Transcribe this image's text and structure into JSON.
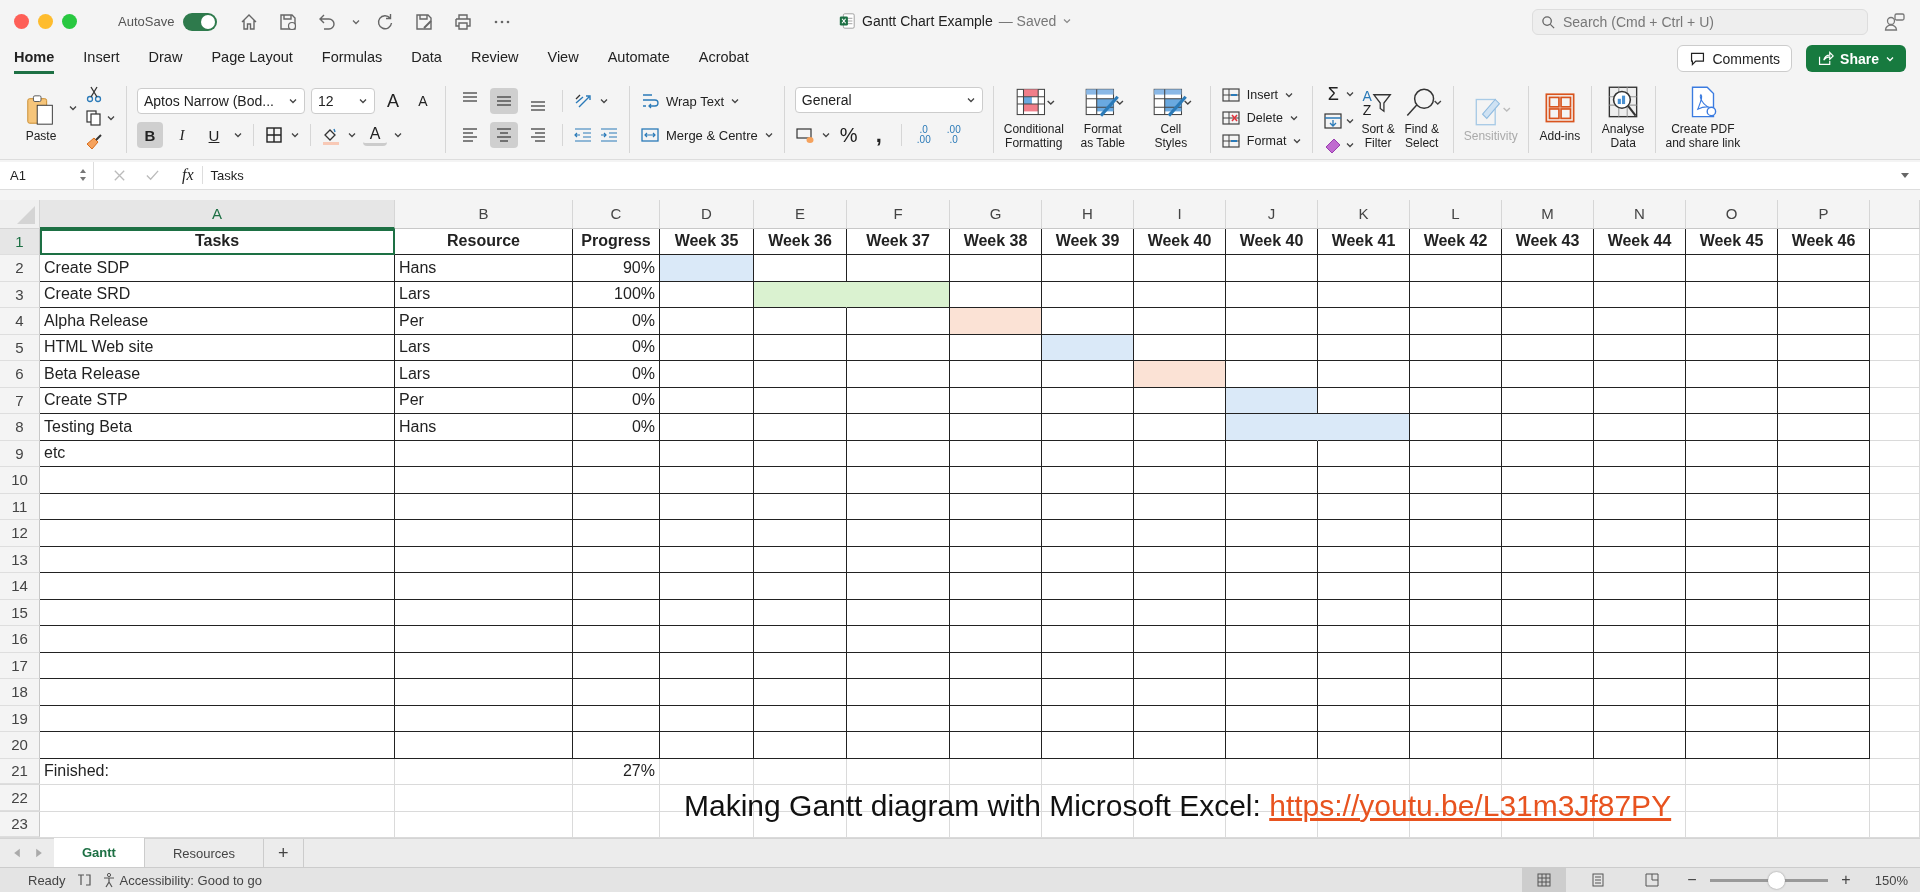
{
  "title_bar": {
    "autosave_label": "AutoSave",
    "autosave_on": true,
    "title": "Gantt Chart Example",
    "status": "— Saved",
    "search_placeholder": "Search (Cmd + Ctrl + U)"
  },
  "ribbon_tabs": [
    {
      "label": "Home",
      "selected": true
    },
    {
      "label": "Insert",
      "selected": false
    },
    {
      "label": "Draw",
      "selected": false
    },
    {
      "label": "Page Layout",
      "selected": false
    },
    {
      "label": "Formulas",
      "selected": false
    },
    {
      "label": "Data",
      "selected": false
    },
    {
      "label": "Review",
      "selected": false
    },
    {
      "label": "View",
      "selected": false
    },
    {
      "label": "Automate",
      "selected": false
    },
    {
      "label": "Acrobat",
      "selected": false
    }
  ],
  "comments_button": "Comments",
  "share_button": "Share",
  "ribbon": {
    "paste": "Paste",
    "font_name": "Aptos Narrow (Bod...",
    "font_size": "12",
    "grow_font": "A",
    "shrink_font": "A",
    "font_buttons": [
      {
        "kind": "bold",
        "label": "B",
        "pressed": true
      },
      {
        "kind": "italic",
        "label": "I",
        "pressed": false
      },
      {
        "kind": "underline",
        "label": "U",
        "pressed": false
      }
    ],
    "font_color": "A",
    "align_top": [
      {
        "kind": "top",
        "pressed": false
      },
      {
        "kind": "middle",
        "pressed": true
      },
      {
        "kind": "bottom",
        "pressed": false
      }
    ],
    "align_bottom": [
      {
        "kind": "left",
        "pressed": false
      },
      {
        "kind": "center",
        "pressed": true
      },
      {
        "kind": "right",
        "pressed": false
      }
    ],
    "wrap_text": "Wrap Text",
    "merge": "Merge & Centre",
    "number_format": "General",
    "percent": "%",
    "comma": ",",
    "decimals": [
      {
        "top": ".0",
        "bottom": ".00"
      },
      {
        "top": ".00",
        "bottom": ".0"
      }
    ],
    "styles": [
      "Conditional\nFormatting",
      "Format\nas Table",
      "Cell\nStyles"
    ],
    "cells": [
      "Insert",
      "Delete",
      "Format"
    ],
    "sum": "Σ",
    "sort_glyphs": [
      "A",
      "Z"
    ],
    "sort": "Sort &\nFilter",
    "find": "Find &\nSelect",
    "sensitivity": "Sensitivity",
    "addins": "Add-ins",
    "analyse": "Analyse\nData",
    "pdf": "Create PDF\nand share link"
  },
  "formula_bar": {
    "name_box": "A1",
    "fx": "fx",
    "value": "Tasks"
  },
  "columns": [
    {
      "letter": "A",
      "selected": true
    },
    {
      "letter": "B",
      "selected": false
    },
    {
      "letter": "C",
      "selected": false
    },
    {
      "letter": "D",
      "selected": false
    },
    {
      "letter": "E",
      "selected": false
    },
    {
      "letter": "F",
      "selected": false
    },
    {
      "letter": "G",
      "selected": false
    },
    {
      "letter": "H",
      "selected": false
    },
    {
      "letter": "I",
      "selected": false
    },
    {
      "letter": "J",
      "selected": false
    },
    {
      "letter": "K",
      "selected": false
    },
    {
      "letter": "L",
      "selected": false
    },
    {
      "letter": "M",
      "selected": false
    },
    {
      "letter": "N",
      "selected": false
    },
    {
      "letter": "O",
      "selected": false
    },
    {
      "letter": "P",
      "selected": false
    }
  ],
  "table_rows": [
    {
      "kind": "header",
      "number": "1",
      "selected": true,
      "task": "Tasks",
      "resource": "Resource",
      "progress": "Progress",
      "weeks": [
        {
          "label": "Week 35"
        },
        {
          "label": "Week 36"
        },
        {
          "label": "Week 37"
        },
        {
          "label": "Week 38"
        },
        {
          "label": "Week 39"
        },
        {
          "label": "Week 40"
        },
        {
          "label": "Week 40"
        },
        {
          "label": "Week 41"
        },
        {
          "label": "Week 42"
        },
        {
          "label": "Week 43"
        },
        {
          "label": "Week 44"
        },
        {
          "label": "Week 45"
        },
        {
          "label": "Week 46"
        }
      ]
    },
    {
      "kind": "task",
      "number": "2",
      "selected": false,
      "task": "Create SDP",
      "resource": "Hans",
      "progress": "90%",
      "weeks": [
        {
          "filled": true,
          "color": "#dae9f8"
        },
        {
          "filled": false
        },
        {
          "filled": false
        },
        {
          "filled": false
        },
        {
          "filled": false
        },
        {
          "filled": false
        },
        {
          "filled": false
        },
        {
          "filled": false
        },
        {
          "filled": false
        },
        {
          "filled": false
        },
        {
          "filled": false
        },
        {
          "filled": false
        },
        {
          "filled": false
        }
      ]
    },
    {
      "kind": "task",
      "number": "3",
      "selected": false,
      "task": "Create SRD",
      "resource": "Lars",
      "progress": "100%",
      "weeks": [
        {
          "filled": false
        },
        {
          "filled": true,
          "color": "#daf2d0"
        },
        {
          "filled": true,
          "color": "#daf2d0"
        },
        {
          "filled": false
        },
        {
          "filled": false
        },
        {
          "filled": false
        },
        {
          "filled": false
        },
        {
          "filled": false
        },
        {
          "filled": false
        },
        {
          "filled": false
        },
        {
          "filled": false
        },
        {
          "filled": false
        },
        {
          "filled": false
        }
      ]
    },
    {
      "kind": "task",
      "number": "4",
      "selected": false,
      "task": "Alpha Release",
      "resource": "Per",
      "progress": "0%",
      "weeks": [
        {
          "filled": false
        },
        {
          "filled": false
        },
        {
          "filled": false
        },
        {
          "filled": true,
          "color": "#fbe2d5"
        },
        {
          "filled": false
        },
        {
          "filled": false
        },
        {
          "filled": false
        },
        {
          "filled": false
        },
        {
          "filled": false
        },
        {
          "filled": false
        },
        {
          "filled": false
        },
        {
          "filled": false
        },
        {
          "filled": false
        }
      ]
    },
    {
      "kind": "task",
      "number": "5",
      "selected": false,
      "task": "HTML Web site",
      "resource": "Lars",
      "progress": "0%",
      "weeks": [
        {
          "filled": false
        },
        {
          "filled": false
        },
        {
          "filled": false
        },
        {
          "filled": false
        },
        {
          "filled": true,
          "color": "#dae9f8"
        },
        {
          "filled": false
        },
        {
          "filled": false
        },
        {
          "filled": false
        },
        {
          "filled": false
        },
        {
          "filled": false
        },
        {
          "filled": false
        },
        {
          "filled": false
        },
        {
          "filled": false
        }
      ]
    },
    {
      "kind": "task",
      "number": "6",
      "selected": false,
      "task": "Beta Release",
      "resource": "Lars",
      "progress": "0%",
      "weeks": [
        {
          "filled": false
        },
        {
          "filled": false
        },
        {
          "filled": false
        },
        {
          "filled": false
        },
        {
          "filled": false
        },
        {
          "filled": true,
          "color": "#fbe2d5"
        },
        {
          "filled": false
        },
        {
          "filled": false
        },
        {
          "filled": false
        },
        {
          "filled": false
        },
        {
          "filled": false
        },
        {
          "filled": false
        },
        {
          "filled": false
        }
      ]
    },
    {
      "kind": "task",
      "number": "7",
      "selected": false,
      "task": "Create STP",
      "resource": "Per",
      "progress": "0%",
      "weeks": [
        {
          "filled": false
        },
        {
          "filled": false
        },
        {
          "filled": false
        },
        {
          "filled": false
        },
        {
          "filled": false
        },
        {
          "filled": false
        },
        {
          "filled": true,
          "color": "#dae9f8"
        },
        {
          "filled": false
        },
        {
          "filled": false
        },
        {
          "filled": false
        },
        {
          "filled": false
        },
        {
          "filled": false
        },
        {
          "filled": false
        }
      ]
    },
    {
      "kind": "task",
      "number": "8",
      "selected": false,
      "task": "Testing Beta",
      "resource": "Hans",
      "progress": "0%",
      "weeks": [
        {
          "filled": false
        },
        {
          "filled": false
        },
        {
          "filled": false
        },
        {
          "filled": false
        },
        {
          "filled": false
        },
        {
          "filled": false
        },
        {
          "filled": true,
          "color": "#dae9f8"
        },
        {
          "filled": true,
          "color": "#dae9f8"
        },
        {
          "filled": false
        },
        {
          "filled": false
        },
        {
          "filled": false
        },
        {
          "filled": false
        },
        {
          "filled": false
        }
      ]
    },
    {
      "kind": "task",
      "number": "9",
      "selected": false,
      "task": "etc"
    },
    {
      "kind": "blank",
      "number": "10",
      "selected": false
    },
    {
      "kind": "blank",
      "number": "11",
      "selected": false
    },
    {
      "kind": "blank",
      "number": "12",
      "selected": false
    },
    {
      "kind": "blank",
      "number": "13",
      "selected": false
    },
    {
      "kind": "blank",
      "number": "14",
      "selected": false
    },
    {
      "kind": "blank",
      "number": "15",
      "selected": false
    },
    {
      "kind": "blank",
      "number": "16",
      "selected": false
    },
    {
      "kind": "blank",
      "number": "17",
      "selected": false
    },
    {
      "kind": "blank",
      "number": "18",
      "selected": false
    },
    {
      "kind": "blank",
      "number": "19",
      "selected": false
    },
    {
      "kind": "blank",
      "number": "20",
      "selected": false
    }
  ],
  "below_rows": [
    {
      "kind": "summary",
      "number": "21",
      "selected": false,
      "task": "Finished:",
      "progress": "27%"
    },
    {
      "kind": "blank",
      "number": "22",
      "selected": false
    },
    {
      "kind": "blank",
      "number": "23",
      "selected": false
    }
  ],
  "note": {
    "text": "Making Gantt diagram with Microsoft Excel:",
    "link": "https://youtu.be/L31m3Jf87PY"
  },
  "sheet_tabs": [
    {
      "label": "Gantt",
      "selected": true
    },
    {
      "label": "Resources",
      "selected": false
    }
  ],
  "add_sheet": "+",
  "status_bar": {
    "ready": "Ready",
    "accessibility": "Accessibility: Good to go",
    "views": [
      {
        "kind": "normal",
        "selected": true
      },
      {
        "kind": "layout",
        "selected": false
      },
      {
        "kind": "break",
        "selected": false
      }
    ],
    "zoom_out": "−",
    "zoom_in": "+",
    "level": 0.56,
    "zoom": "150%"
  }
}
